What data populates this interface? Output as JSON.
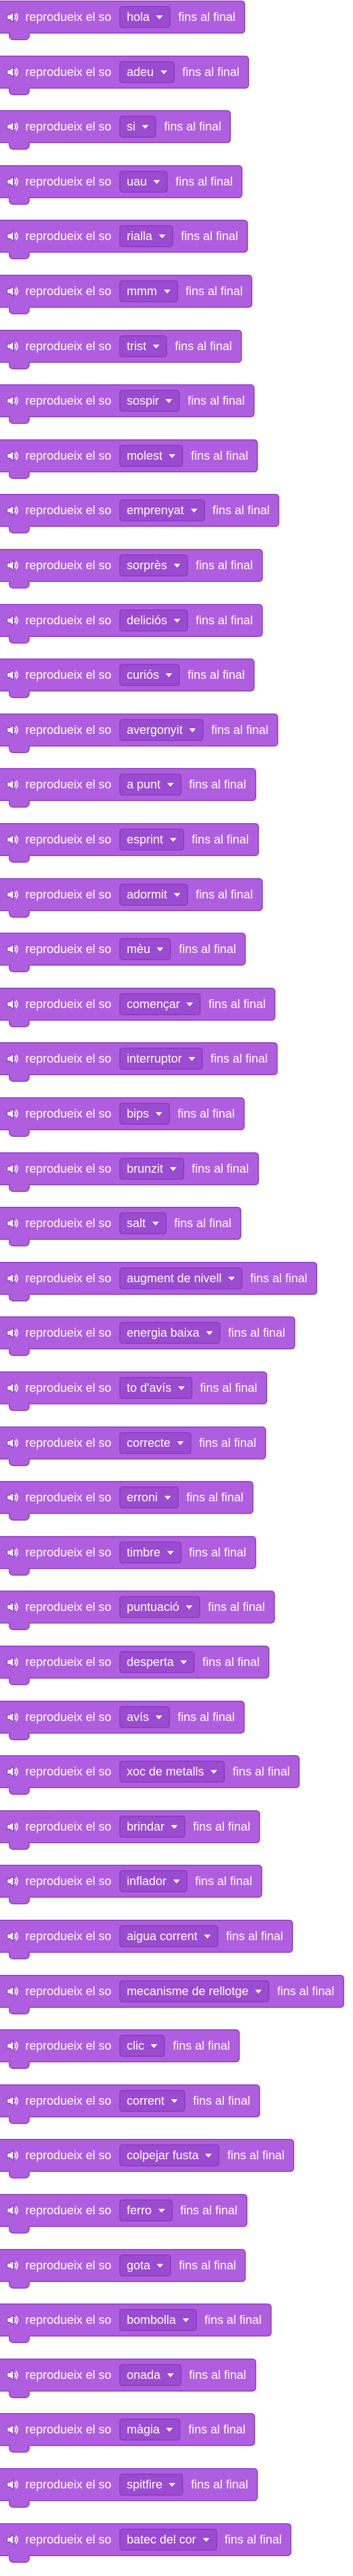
{
  "block": {
    "prefix": "reprodueix el so",
    "suffix": "fins al final",
    "icon": "speaker-icon",
    "color": "#b05ee0",
    "border_color": "#9147c4",
    "dropdown_color": "#9a4bd0"
  },
  "sounds": [
    "hola",
    "adeu",
    "si",
    "uau",
    "rialla",
    "mmm",
    "trist",
    "sospir",
    "molest",
    "emprenyat",
    "sorprès",
    "deliciós",
    "curiós",
    "avergonyit",
    "a punt",
    "esprint",
    "adormit",
    "mèu",
    "començar",
    "interruptor",
    "bips",
    "brunzit",
    "salt",
    "augment de nivell",
    "energia baixa",
    "to d'avís",
    "correcte",
    "erroni",
    "timbre",
    "puntuació",
    "desperta",
    "avís",
    "xoc de metalls",
    "brindar",
    "inflador",
    "aigua corrent",
    "mecanisme de rellotge",
    "clic",
    "corrent",
    "colpejar fusta",
    "ferro",
    "gota",
    "bombolla",
    "onada",
    "màgia",
    "spitfire",
    "batec del cor"
  ]
}
